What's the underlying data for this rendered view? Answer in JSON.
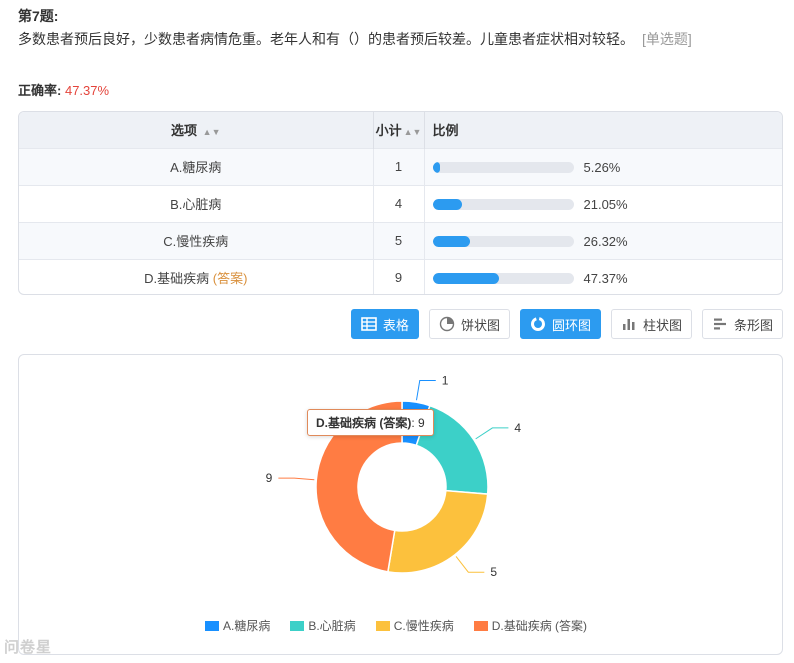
{
  "question": {
    "title": "第7题:",
    "text": "多数患者预后良好，少数患者病情危重。老年人和有（）的患者预后较差。儿童患者症状相对较轻。",
    "type": "[单选题]",
    "accuracy_label": "正确率:",
    "accuracy_value": "47.37%"
  },
  "table": {
    "headers": {
      "option": "选项",
      "count": "小计",
      "ratio": "比例"
    },
    "rows": [
      {
        "option": "A.糖尿病",
        "answer_tag": "",
        "count": "1",
        "percent": "5.26%",
        "fraction": 0.0526
      },
      {
        "option": "B.心脏病",
        "answer_tag": "",
        "count": "4",
        "percent": "21.05%",
        "fraction": 0.2105
      },
      {
        "option": "C.慢性疾病",
        "answer_tag": "",
        "count": "5",
        "percent": "26.32%",
        "fraction": 0.2632
      },
      {
        "option": "D.基础疾病",
        "answer_tag": "(答案)",
        "count": "9",
        "percent": "47.37%",
        "fraction": 0.4737
      }
    ]
  },
  "view_buttons": [
    {
      "label": "表格",
      "icon": "table-icon",
      "active": true
    },
    {
      "label": "饼状图",
      "icon": "pie-chart-icon",
      "active": false
    },
    {
      "label": "圆环图",
      "icon": "donut-chart-icon",
      "active": true
    },
    {
      "label": "柱状图",
      "icon": "bar-chart-icon",
      "active": false
    },
    {
      "label": "条形图",
      "icon": "horizontal-bar-icon",
      "active": false
    }
  ],
  "chart_data": {
    "type": "pie",
    "variant": "donut",
    "categories": [
      "A.糖尿病",
      "B.心脏病",
      "C.慢性疾病",
      "D.基础疾病 (答案)"
    ],
    "values": [
      1,
      4,
      5,
      9
    ],
    "colors": [
      "#1890ff",
      "#3cd0c8",
      "#fcc13d",
      "#ff7c43"
    ],
    "legend_position": "bottom",
    "tooltip": {
      "name": "D.基础疾病 (答案)",
      "value": "9"
    }
  },
  "watermark": "问卷星"
}
